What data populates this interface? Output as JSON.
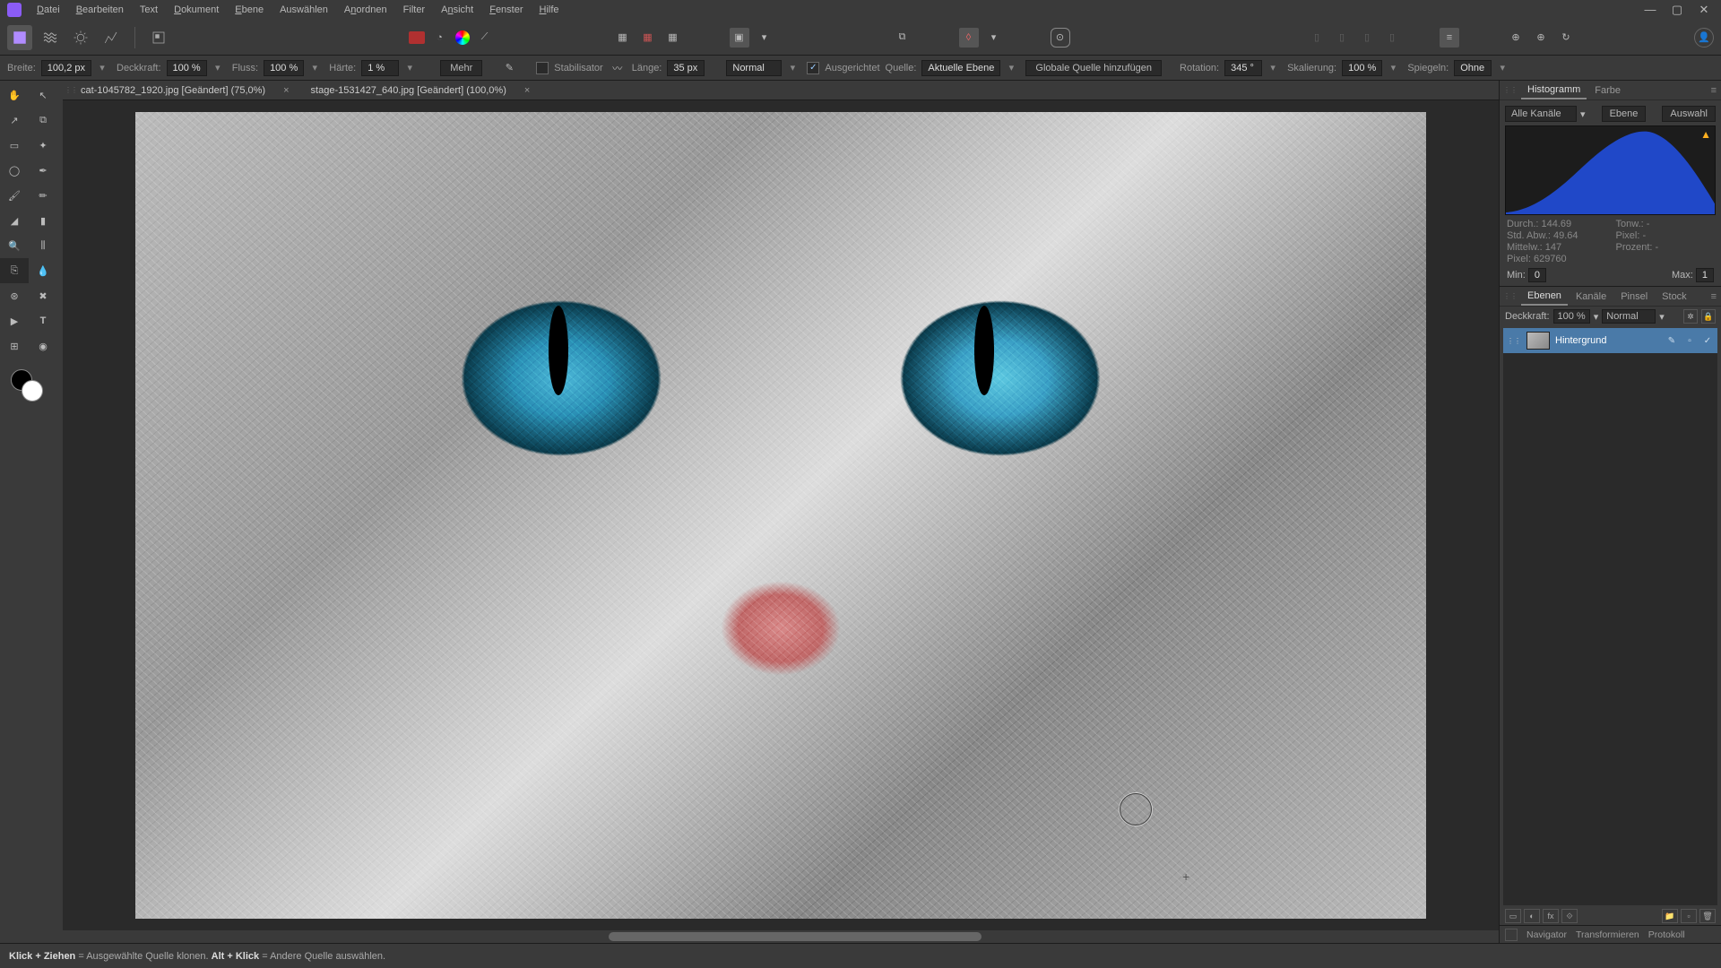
{
  "menu": {
    "items": [
      "Datei",
      "Bearbeiten",
      "Text",
      "Dokument",
      "Ebene",
      "Auswählen",
      "Anordnen",
      "Filter",
      "Ansicht",
      "Fenster",
      "Hilfe"
    ],
    "underline": [
      0,
      0,
      -1,
      0,
      0,
      -1,
      1,
      -1,
      1,
      0,
      0
    ]
  },
  "window": {
    "min": "—",
    "max": "▢",
    "close": "✕"
  },
  "context": {
    "width_lbl": "Breite:",
    "width": "100,2 px",
    "opacity_lbl": "Deckkraft:",
    "opacity": "100 %",
    "flow_lbl": "Fluss:",
    "flow": "100 %",
    "hard_lbl": "Härte:",
    "hard": "1 %",
    "more": "Mehr",
    "stabil": "Stabilisator",
    "len_lbl": "Länge:",
    "len": "35 px",
    "blend": "Normal",
    "aligned": "Ausgerichtet",
    "source_lbl": "Quelle:",
    "source": "Aktuelle Ebene",
    "addglobal": "Globale Quelle hinzufügen",
    "rot_lbl": "Rotation:",
    "rot": "345 °",
    "scale_lbl": "Skalierung:",
    "scale": "100 %",
    "mirror_lbl": "Spiegeln:",
    "mirror": "Ohne"
  },
  "tabs": [
    {
      "title": "cat-1045782_1920.jpg [Geändert] (75,0%)"
    },
    {
      "title": "stage-1531427_640.jpg [Geändert] (100,0%)"
    }
  ],
  "histogram": {
    "tab1": "Histogramm",
    "tab2": "Farbe",
    "channel": "Alle Kanäle",
    "b1": "Ebene",
    "b2": "Auswahl",
    "stats": {
      "durch": "Durch.: 144.69",
      "tonw": "Tonw.: -",
      "std": "Std. Abw.: 49.64",
      "pixelp": "Pixel: -",
      "mittel": "Mittelw.: 147",
      "prozent": "Prozent: -",
      "pixel": "Pixel: 629760"
    },
    "min_lbl": "Min:",
    "min": "0",
    "max_lbl": "Max:",
    "max": "1"
  },
  "layers": {
    "tabs": [
      "Ebenen",
      "Kanäle",
      "Pinsel",
      "Stock"
    ],
    "op_lbl": "Deckkraft:",
    "op": "100 %",
    "blend": "Normal",
    "layer_name": "Hintergrund"
  },
  "bottom_panels": [
    "Navigator",
    "Transformieren",
    "Protokoll"
  ],
  "chart_data": {
    "type": "area",
    "title": "Histogramm",
    "xlabel": "",
    "ylabel": "",
    "x": [
      0,
      32,
      64,
      96,
      128,
      160,
      192,
      224,
      255
    ],
    "values": [
      2,
      6,
      22,
      48,
      78,
      95,
      70,
      36,
      12
    ],
    "ylim": [
      0,
      100
    ],
    "xlim": [
      0,
      255
    ],
    "color": "#2048c8"
  },
  "status": {
    "s1": "Klick + Ziehen",
    "t1": " = Ausgewählte Quelle klonen. ",
    "s2": "Alt + Klick",
    "t2": " = Andere Quelle auswählen."
  }
}
